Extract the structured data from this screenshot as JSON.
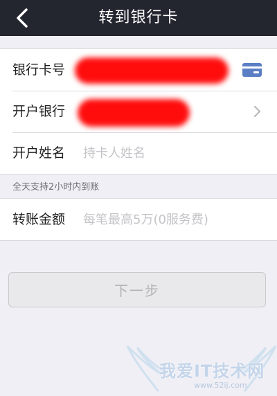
{
  "navbar": {
    "title": "转到银行卡",
    "back_icon": "chevron-left-icon"
  },
  "form": {
    "card_number": {
      "label": "银行卡号",
      "value": "",
      "icon": "bank-card-icon"
    },
    "bank": {
      "label": "开户银行",
      "value": "",
      "icon": "chevron-right-icon"
    },
    "holder_name": {
      "label": "开户姓名",
      "placeholder": "持卡人姓名"
    },
    "notice": "全天支持2小时内到账",
    "amount": {
      "label": "转账金额",
      "placeholder": "每笔最高5万(0服务费)"
    }
  },
  "actions": {
    "next_label": "下一步"
  },
  "watermark": {
    "text": "我爱IT技术网",
    "url": "www.52ij.com"
  },
  "colors": {
    "navbar": "#23252f",
    "background": "#f0eff5",
    "card_icon": "#5b7fc4",
    "redaction": "#ff0d0d"
  }
}
